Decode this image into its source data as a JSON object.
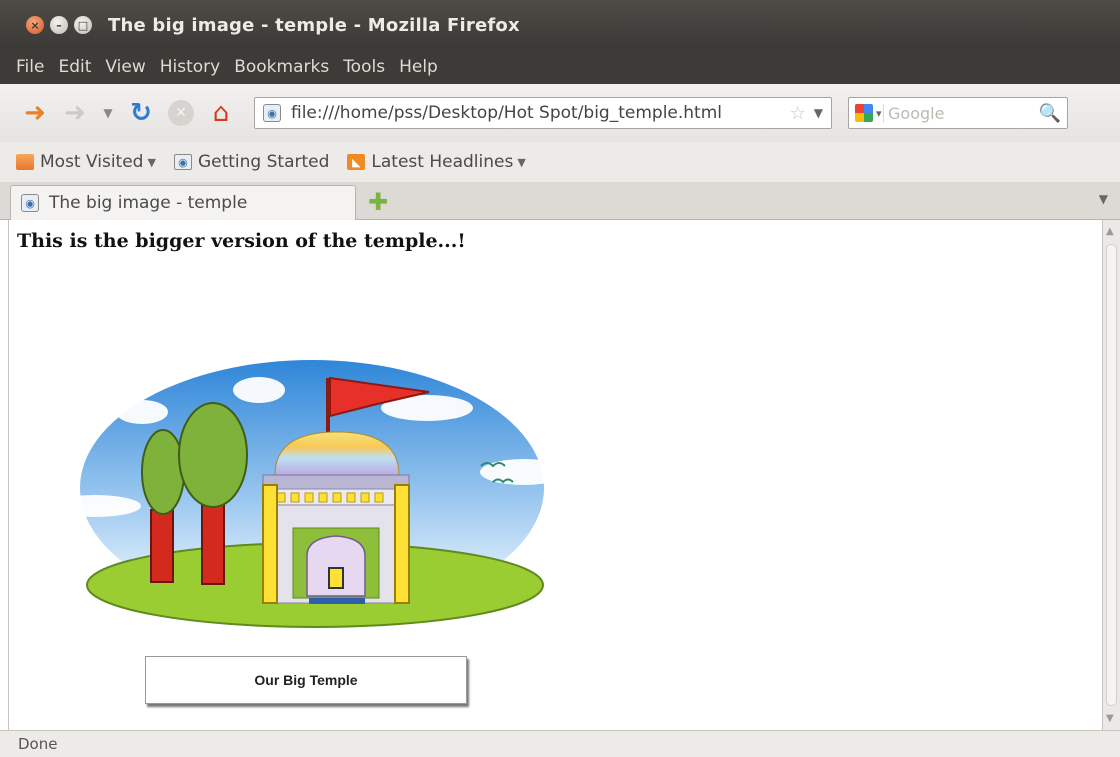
{
  "window": {
    "title": "The big image - temple - Mozilla Firefox"
  },
  "menu": [
    "File",
    "Edit",
    "View",
    "History",
    "Bookmarks",
    "Tools",
    "Help"
  ],
  "navigation": {
    "url": "file:///home/pss/Desktop/Hot Spot/big_temple.html",
    "search_placeholder": "Google",
    "icons": [
      "back-arrow-icon",
      "forward-arrow-icon",
      "history-dropdown-icon",
      "reload-icon",
      "stop-icon",
      "home-icon",
      "bookmark-star-icon",
      "search-icon"
    ]
  },
  "bookmarks": [
    {
      "label": "Most Visited",
      "icon": "folder-icon",
      "dropdown": true
    },
    {
      "label": "Getting Started",
      "icon": "page-icon",
      "dropdown": false
    },
    {
      "label": "Latest Headlines",
      "icon": "rss-icon",
      "dropdown": true
    }
  ],
  "tabs": [
    {
      "label": "The big image - temple",
      "active": true
    }
  ],
  "page": {
    "heading": "This is the bigger version of the temple...!",
    "caption": "Our Big Temple"
  },
  "status": "Done",
  "colors": {
    "titlebar": "#3c3b37",
    "sky": "#3a8fd9",
    "grass": "#9acd32",
    "trunk": "#d42a1e",
    "flag": "#e8302a",
    "pillar": "#ffe135"
  }
}
